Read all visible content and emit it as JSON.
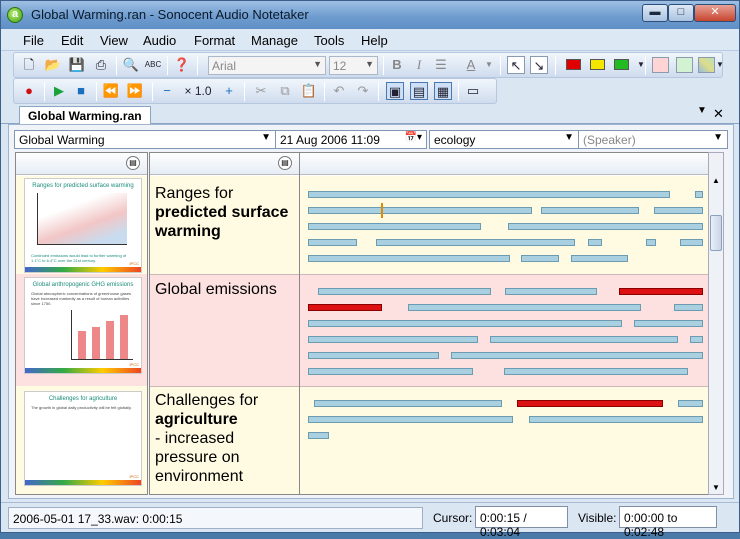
{
  "window": {
    "title": "Global Warming.ran - Sonocent Audio Notetaker"
  },
  "menu": [
    "File",
    "Edit",
    "View",
    "Audio",
    "Format",
    "Manage",
    "Tools",
    "Help"
  ],
  "toolbar": {
    "font_name": "Arial",
    "font_size": "12",
    "speed": "× 1.0",
    "colors": {
      "red": "#e00000",
      "yellow": "#f5e600",
      "green": "#22bb22",
      "pink_box": "#ffd4d4",
      "green_box": "#d2f2d2",
      "yellow_box": "#f4f4c8"
    }
  },
  "document_tab": {
    "label": "Global Warming.ran"
  },
  "selectors": {
    "topic": "Global Warming",
    "date": "21 Aug  2006 11:09",
    "category": "ecology",
    "speaker_placeholder": "(Speaker)"
  },
  "sections": [
    {
      "slide_title": "Ranges for predicted surface warming",
      "slide_foot": "Continued emissions would lead to further warming of 1.1°C to 6.4°C over the 21st century.",
      "slide_label": "IPCC",
      "text_normal": "Ranges for",
      "text_bold": "predicted surface warming",
      "text_after": "",
      "highlight": "yellow"
    },
    {
      "slide_title": "Global anthropogenic GHG emissions",
      "slide_body": "Global atmospheric concentrations of greenhouse gases have increased markedly as a result of human activities since 1750.",
      "slide_label": "IPCC",
      "text_normal": "Global emissions",
      "text_bold": "",
      "text_after": "",
      "highlight": "pink"
    },
    {
      "slide_title": "Challenges for agriculture",
      "slide_body": "The growth in global daily productivity will be felt globally.",
      "slide_label": "IPCC",
      "text_normal": "Challenges for",
      "text_bold": "agriculture",
      "text_after": "- increased pressure on environment",
      "highlight": "yellow"
    }
  ],
  "status": {
    "file": "2006-05-01 17_33.wav: 0:00:15",
    "cursor_label": "Cursor:",
    "cursor_value": "0:00:15 / 0:03:04",
    "visible_label": "Visible:",
    "visible_value": "0:00:00 to 0:02:48"
  }
}
